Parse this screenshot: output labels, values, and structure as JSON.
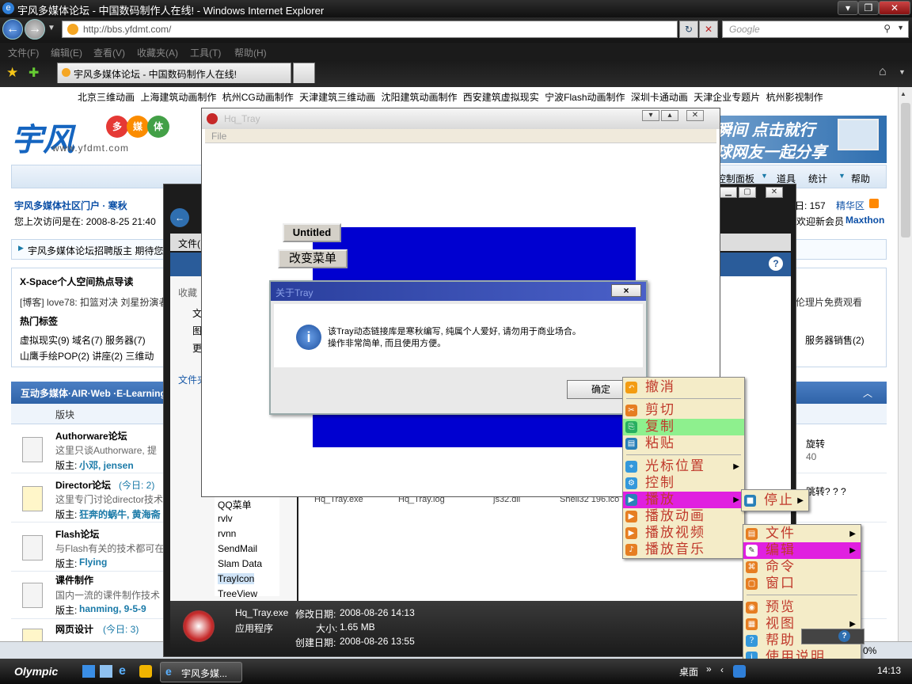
{
  "browser": {
    "title": "宇风多媒体论坛 - 中国数码制作人在线! - Windows Internet Explorer",
    "url": "http://bbs.yfdmt.com/",
    "search_placeholder": "Google",
    "menu": [
      "文件(F)",
      "编辑(E)",
      "查看(V)",
      "收藏夹(A)",
      "工具(T)",
      "帮助(H)"
    ],
    "tab_label": "宇风多媒体论坛 - 中国数码制作人在线!"
  },
  "page": {
    "top_links": [
      "北京三维动画",
      "上海建筑动画制作",
      "杭州CG动画制作",
      "天津建筑三维动画",
      "沈阳建筑动画制作",
      "西安建筑虚拟现实",
      "宁波Flash动画制作",
      "深圳卡通动画",
      "天津企业专题片",
      "杭州影视制作"
    ],
    "logo_url": "www.yfdmt.com",
    "banner_text1": "瞬间 点击就行",
    "banner_text2": "球网友一起分享",
    "nav_right": [
      "控制面板",
      "道具",
      "统计",
      "帮助"
    ],
    "user_line": "宇风多媒体社区门户 · 寒秋",
    "last_visit": "您上次访问是在: 2008-8-25 21:40",
    "stats_right": "日: 157",
    "elite": "精华区",
    "welcome_new": "欢迎新会员",
    "new_member": "Maxthon",
    "notice": "宇风多媒体论坛招聘版主 期待您",
    "xspace_title": "X-Space个人空间热点导读",
    "xspace_line": "[博客] love78: 扣篮对决 刘星扮演者",
    "xspace_right": "伦理片免费观看",
    "hot_tags_title": "热门标签",
    "tags_row1": "虚拟现实(9)  域名(7)  服务器(7)",
    "tags_row1_right": "服务器销售(2)",
    "tags_row2": "山鹰手绘POP(2)  讲座(2)  三维动",
    "section_title": "互动多媒体·AIR·Web ·E-Learning",
    "col_forum": "版块",
    "forums": [
      {
        "name": "Authorware论坛",
        "today": "",
        "desc": "这里只谈Authorware, 提",
        "mods_label": "版主:",
        "mods": "小邓, jensen"
      },
      {
        "name": "Director论坛",
        "today": "(今日: 2)",
        "desc": "这里专门讨论director技术",
        "mods_label": "版主:",
        "mods": "狂奔的蜗牛, 黄海斋"
      },
      {
        "name": "Flash论坛",
        "today": "",
        "desc": "与Flash有关的技术都可在",
        "mods_label": "版主:",
        "mods": "Flying"
      },
      {
        "name": "课件制作",
        "today": "",
        "desc": "国内一流的课件制作技术",
        "mods_label": "版主:",
        "mods": "hanming, 9-5-9"
      },
      {
        "name": "网页设计",
        "today": "(今日: 3)",
        "desc": "",
        "mods_label": "",
        "mods": ""
      }
    ],
    "right_col_1": "旋转",
    "right_col_1b": "40",
    "right_col_2": "跳转? ? ?"
  },
  "explorer": {
    "menu_file": "文件(",
    "favorites": "收藏",
    "side_letters": [
      "文",
      "图",
      "更"
    ],
    "left_label": "文件夹",
    "folders": [
      "QQ菜单",
      "rvlv",
      "rvnn",
      "SendMail",
      "Slam Data",
      "TrayIcon",
      "TreeView"
    ],
    "file_cols": [
      "Hq_Tray.exe",
      "Hq_Tray.log",
      "js32.dll",
      "Shell32 196.ico"
    ],
    "detail_name": "Hq_Tray.exe",
    "detail_type": "应用程序",
    "modified_label": "修改日期:",
    "modified": "2008-08-26 14:13",
    "size_label": "大小:",
    "size": "1.65 MB",
    "created_label": "创建日期:",
    "created": "2008-08-26 13:55"
  },
  "hqtray": {
    "title": "Hq_Tray",
    "menu_file": "File",
    "btn_untitled": "Untitled",
    "btn_change_menu": "改变菜单"
  },
  "about": {
    "title": "关于Tray",
    "line1": "该Tray动态链接库是寒秋编写, 纯属个人爱好, 请勿用于商业场合。",
    "line2": "操作非常简单, 而且使用方便。",
    "ok": "确定",
    "close": "×"
  },
  "context_menu": {
    "items": [
      "撤消",
      "剪切",
      "复制",
      "粘贴",
      "光标位置",
      "控制",
      "播放",
      "播放动画",
      "播放视频",
      "播放音乐"
    ]
  },
  "submenu_play": {
    "items": [
      "停止"
    ]
  },
  "submenu_main": {
    "items": [
      "文件",
      "编辑",
      "命令",
      "窗口",
      "预览",
      "视图",
      "帮助",
      "使用说明"
    ]
  },
  "colors": {
    "highlight_green": "#8ef08e",
    "highlight_magenta": "#e020e0",
    "menu_bg": "#f4ecc8",
    "blue_fill": "#0000d0"
  },
  "taskbar": {
    "start": "Olympic",
    "ie_task": "宇风多媒...",
    "desktop": "桌面",
    "percent": "0%",
    "clock": "14:13"
  }
}
